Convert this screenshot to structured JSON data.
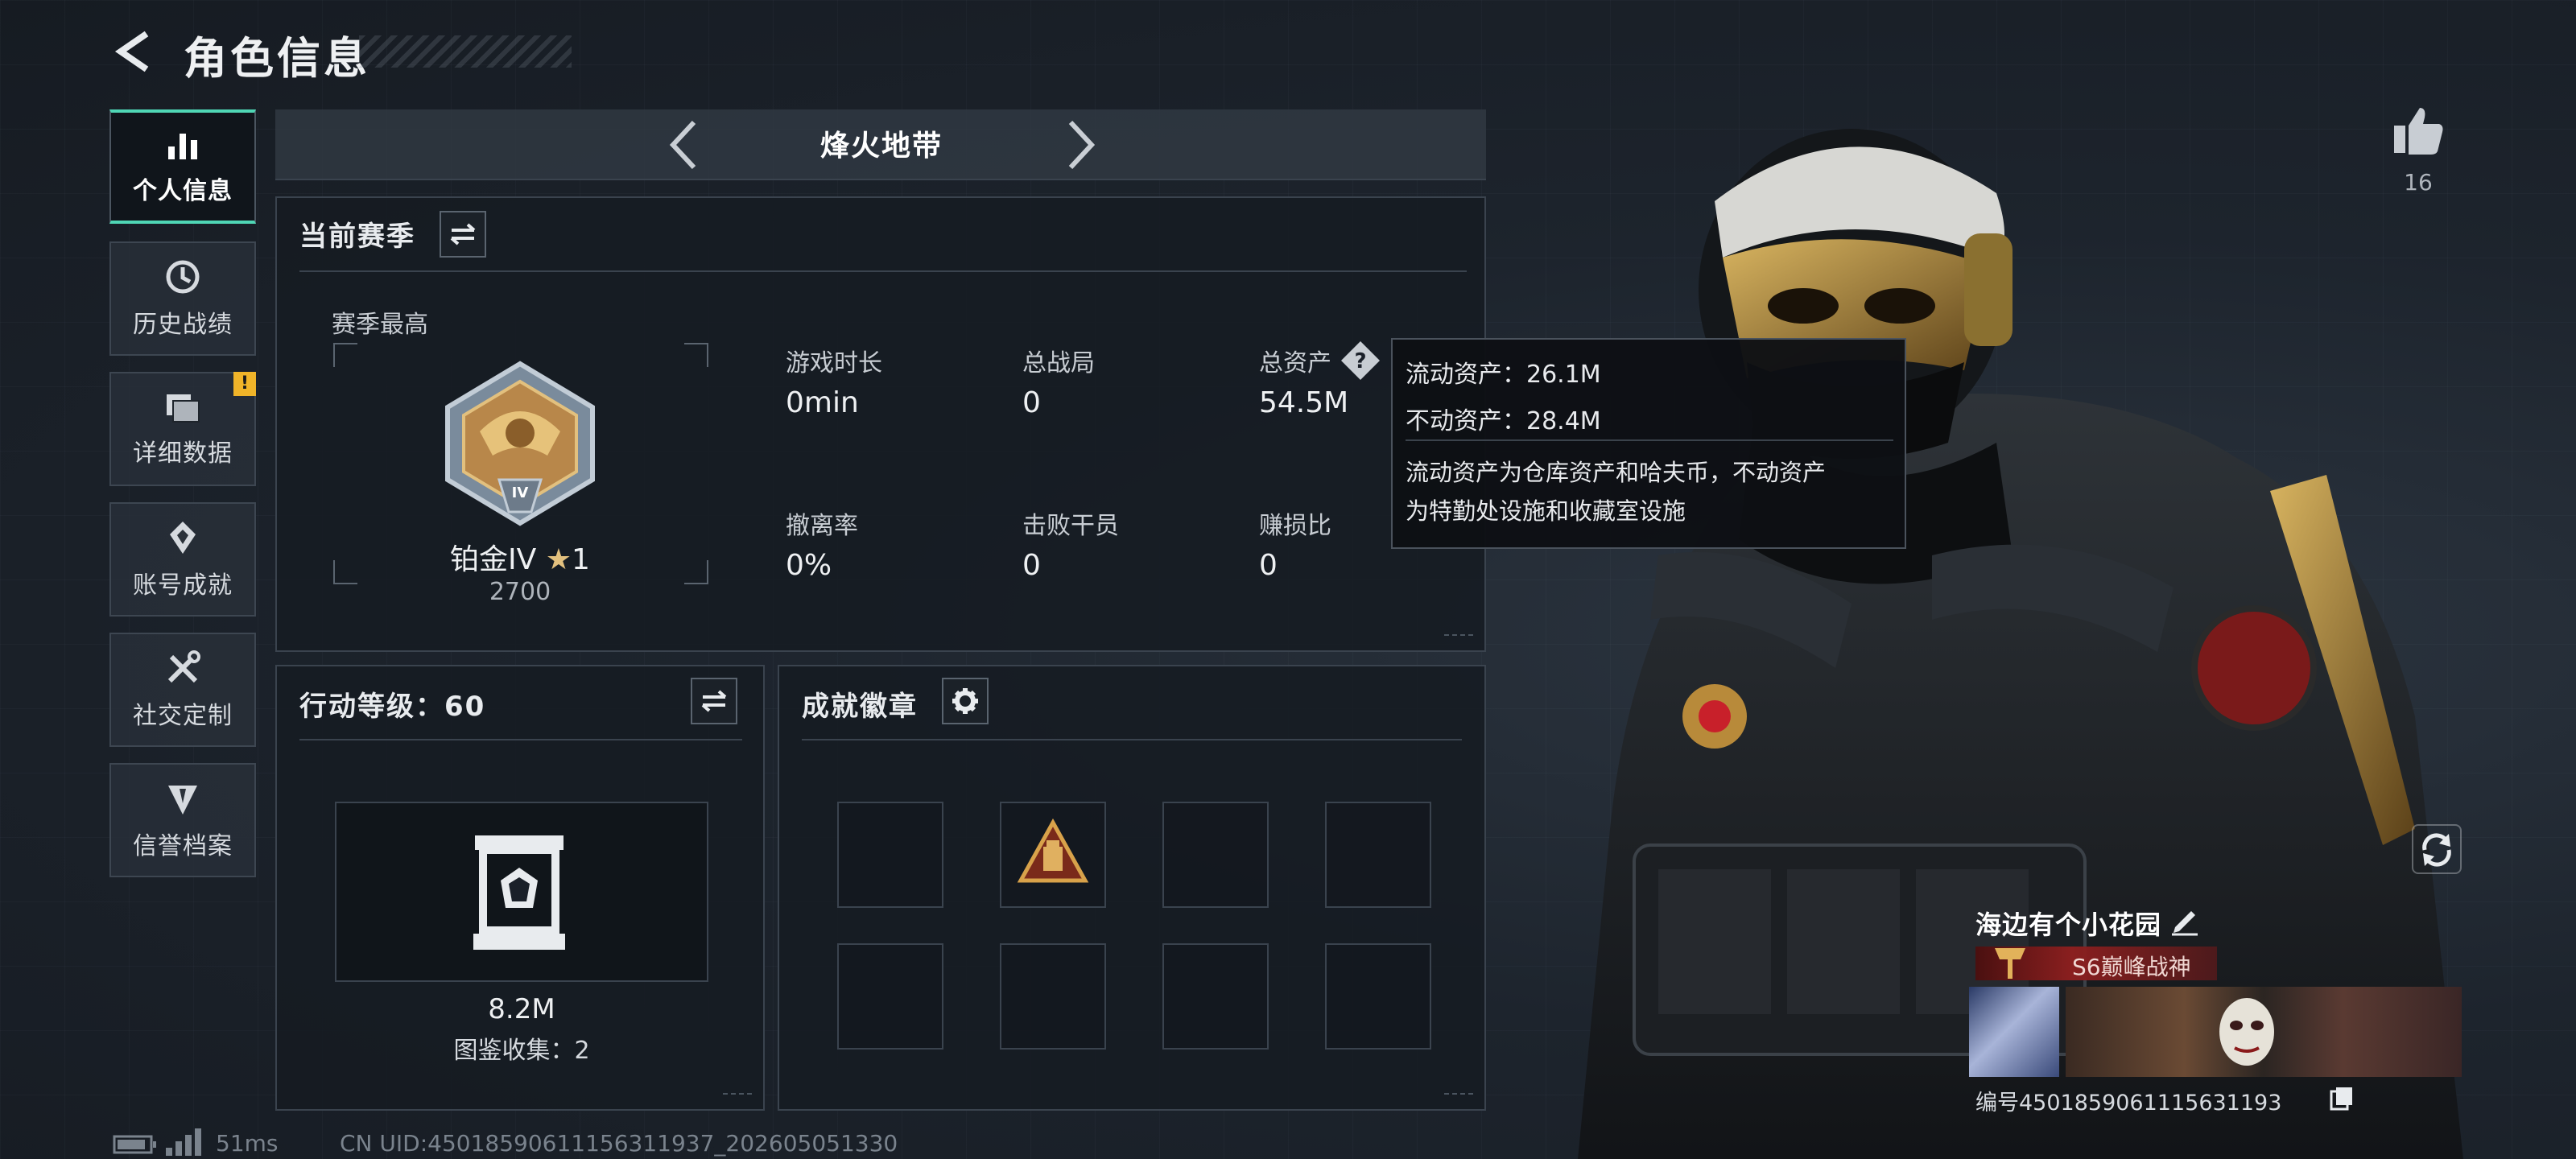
{
  "header": {
    "title": "角色信息"
  },
  "nav": {
    "items": [
      {
        "label": "个人信息",
        "icon": "bar-chart-icon",
        "active": true
      },
      {
        "label": "历史战绩",
        "icon": "history-icon"
      },
      {
        "label": "详细数据",
        "icon": "folder-icon",
        "alert": "!"
      },
      {
        "label": "账号成就",
        "icon": "achievement-icon"
      },
      {
        "label": "社交定制",
        "icon": "tools-icon"
      },
      {
        "label": "信誉档案",
        "icon": "emblem-icon"
      }
    ]
  },
  "mode_selector": {
    "label": "烽火地带"
  },
  "season": {
    "title": "当前赛季",
    "best_label": "赛季最高",
    "rank_name": "铂金IV",
    "rank_stars": "1",
    "rank_score": "2700",
    "rank_numeral": "IV",
    "stats": [
      {
        "label": "游戏时长",
        "value": "0min"
      },
      {
        "label": "总战局",
        "value": "0"
      },
      {
        "label": "总资产",
        "value": "54.5M"
      },
      {
        "label": "撤离率",
        "value": "0%"
      },
      {
        "label": "击败干员",
        "value": "0"
      },
      {
        "label": "赚损比",
        "value": "0"
      }
    ]
  },
  "tooltip": {
    "liquid": "流动资产：26.1M",
    "fixed": "不动资产：28.4M",
    "desc_line1": "流动资产为仓库资产和哈夫币，不动资产",
    "desc_line2": "为特勤处设施和收藏室设施"
  },
  "action_level": {
    "title": "行动等级：60",
    "value": "8.2M",
    "collection": "图鉴收集：2"
  },
  "achievements": {
    "title": "成就徽章"
  },
  "likes": {
    "count": "16"
  },
  "player": {
    "name": "海边有个小花园",
    "title": "S6巅峰战神",
    "id_line": "编号4501859061115631193"
  },
  "footer": {
    "ping": "51ms",
    "uid": "CN UID:4501859061115631193​7_202605051330"
  },
  "colors": {
    "accent": "#4fd6b5",
    "title_bar": "#7a1a1a",
    "alert": "#f0b429"
  }
}
